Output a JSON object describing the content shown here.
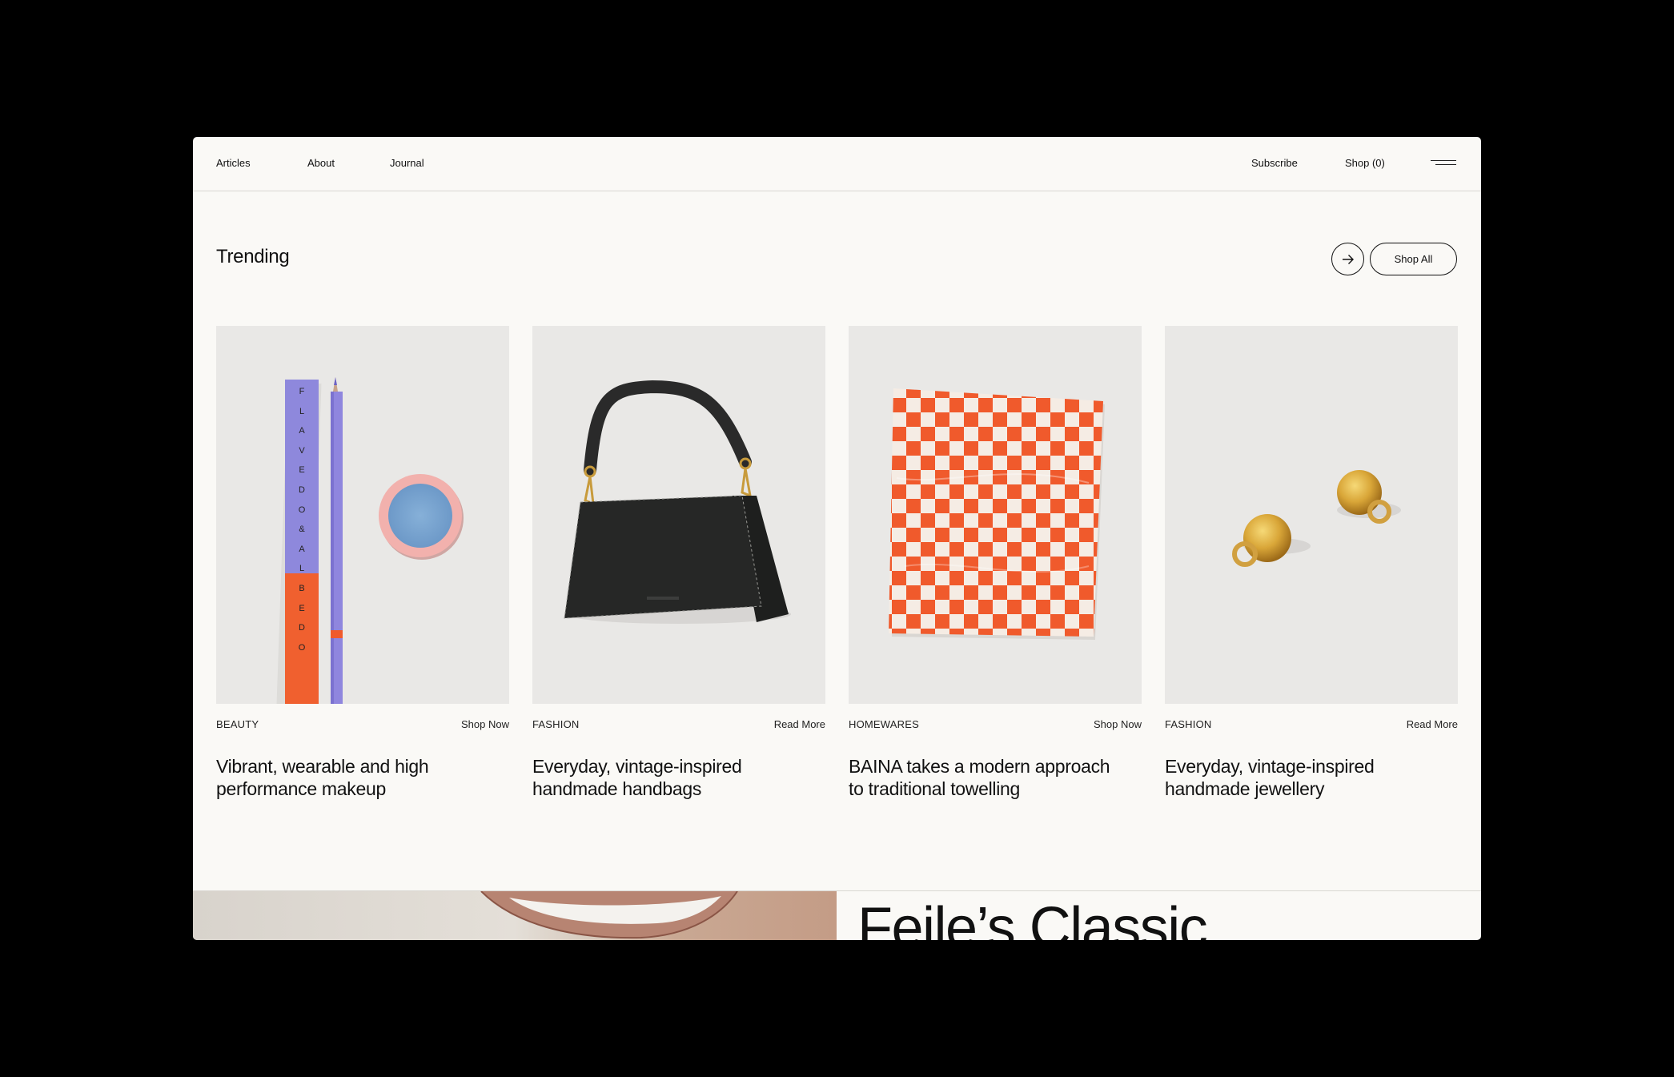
{
  "nav": {
    "left": [
      "Articles",
      "About",
      "Journal"
    ],
    "subscribe": "Subscribe",
    "shop": "Shop (0)"
  },
  "trending": {
    "title": "Trending",
    "shop_all": "Shop All"
  },
  "cards": [
    {
      "category": "BEAUTY",
      "cta": "Shop Now",
      "title": "Vibrant, wearable and high performance makeup"
    },
    {
      "category": "FASHION",
      "cta": "Read More",
      "title": "Everyday, vintage-inspired handmade handbags"
    },
    {
      "category": "HOMEWARES",
      "cta": "Shop Now",
      "title": "BAINA takes a modern approach to traditional towelling"
    },
    {
      "category": "FASHION",
      "cta": "Read More",
      "title": "Everyday, vintage-inspired handmade jewellery"
    }
  ],
  "feature": {
    "title": "Feile’s Classic"
  },
  "colors": {
    "page_bg": "#faf9f6",
    "card_bg": "#e9e8e6",
    "accent_orange": "#f05a2c",
    "accent_lavender": "#8f86e0"
  }
}
